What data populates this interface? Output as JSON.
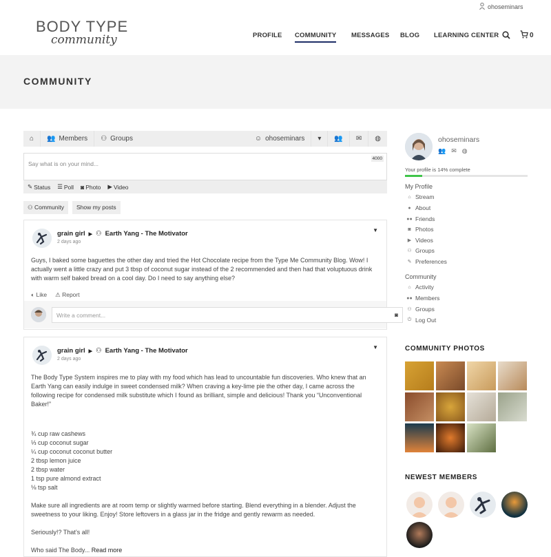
{
  "header": {
    "user_name": "ohoseminars",
    "logo_top": "BODY TYPE",
    "logo_bottom": "community",
    "nav": {
      "profile": "PROFILE",
      "community": "COMMUNITY",
      "messages": "MESSAGES",
      "blog": "BLOG",
      "learning": "LEARNING CENTER"
    },
    "cart_count": "0"
  },
  "hero": {
    "title": "COMMUNITY"
  },
  "toolbar": {
    "members": "Members",
    "groups": "Groups",
    "user": "ohoseminars"
  },
  "composer": {
    "placeholder": "Say what is on your mind...",
    "char_count": "4000",
    "tabs": {
      "status": "Status",
      "poll": "Poll",
      "photo": "Photo",
      "video": "Video"
    }
  },
  "filters": {
    "community": "Community",
    "my_posts": "Show my posts"
  },
  "posts": [
    {
      "author": "grain girl",
      "group": "Earth Yang - The Motivator",
      "time": "2 days ago",
      "body": "Guys, I baked some baguettes the other day and tried the Hot Chocolate recipe from the Type Me Community Blog. Wow! I actually went a little crazy and put 3 tbsp of coconut sugar instead of the 2 recommended and then had that voluptuous drink with warm self baked bread on a cool day. Do I need to say anything else?",
      "like": "Like",
      "report": "Report",
      "comment_placeholder": "Write a comment..."
    },
    {
      "author": "grain girl",
      "group": "Earth Yang - The Motivator",
      "time": "2 days ago",
      "intro": "The Body Type System inspires me to play with my food which has lead to uncountable fun discoveries. Who knew that an Earth Yang can easily indulge in sweet condensed milk? When craving a key-lime pie the other day, I came across the following recipe for condensed milk substitute which I found as brilliant, simple and delicious! Thank you “Unconventional Baker!”",
      "ingredients": [
        "¾ cup raw cashews",
        "⅓ cup coconut sugar",
        "¼ cup coconut coconut butter",
        "2 tbsp lemon juice",
        "2 tbsp water",
        "1 tsp pure almond extract",
        "⅛ tsp salt"
      ],
      "method": "Make sure all ingredients are at room temp or slightly warmed before starting. Blend everything in a blender. Adjust the sweetness to your liking. Enjoy! Store leftovers in a glass jar in the fridge and gently rewarm as needed.",
      "closing": "Seriously!? That’s all!",
      "teaser": "Who said The Body...",
      "read_more": "Read more"
    }
  ],
  "sidebar": {
    "name": "ohoseminars",
    "progress_label": "Your profile is 14% complete",
    "progress": 0.14,
    "my_profile": "My Profile",
    "profile_links": [
      "Stream",
      "About",
      "Friends",
      "Photos",
      "Videos",
      "Groups",
      "Preferences"
    ],
    "community": "Community",
    "community_links": [
      "Activity",
      "Members",
      "Groups",
      "Log Out"
    ],
    "photos_heading": "COMMUNITY PHOTOS",
    "members_heading": "NEWEST MEMBERS"
  },
  "colors": {
    "accent": "#1d2d66",
    "progress": "#3fc449",
    "hero": "#f3f3f3"
  }
}
